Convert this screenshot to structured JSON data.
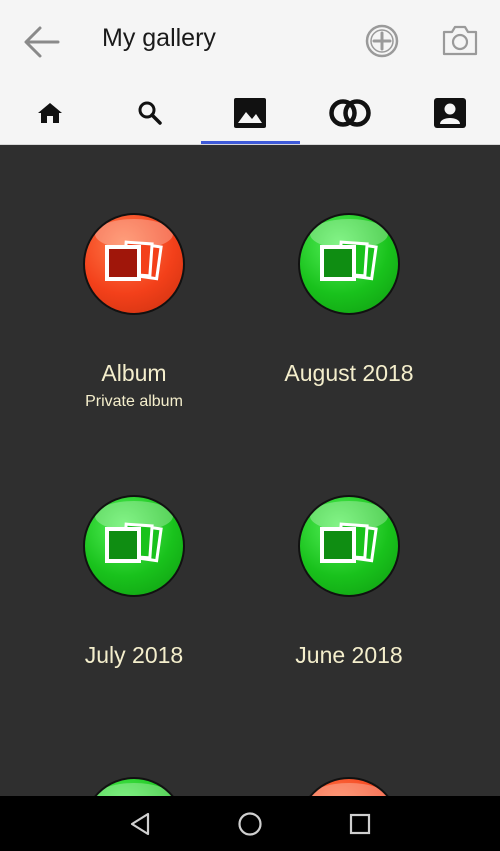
{
  "header": {
    "title": "My gallery",
    "back_icon": "arrow-left-icon",
    "actions": [
      {
        "name": "add-album",
        "icon": "circle-plus-icon"
      },
      {
        "name": "camera",
        "icon": "camera-icon"
      }
    ]
  },
  "tabs": [
    {
      "icon": "home-icon",
      "active": false
    },
    {
      "icon": "search-icon",
      "active": false
    },
    {
      "icon": "image-icon",
      "active": true
    },
    {
      "icon": "linked-rings-icon",
      "active": false
    },
    {
      "icon": "contact-icon",
      "active": false
    }
  ],
  "albums": [
    {
      "label": "Album",
      "sublabel": "Private album",
      "color": "red"
    },
    {
      "label": "August 2018",
      "sublabel": "",
      "color": "green"
    },
    {
      "label": "July 2018",
      "sublabel": "",
      "color": "green"
    },
    {
      "label": "June 2018",
      "sublabel": "",
      "color": "green"
    },
    {
      "label": "",
      "sublabel": "",
      "color": "green"
    },
    {
      "label": "",
      "sublabel": "",
      "color": "red"
    }
  ],
  "colors": {
    "accent": "#3f5ad8",
    "background": "#2f2f2f",
    "label": "#f4eecc",
    "green": "#19c21c",
    "red": "#f3401a"
  },
  "system_nav": [
    "back-triangle-icon",
    "home-circle-icon",
    "recents-square-icon"
  ]
}
